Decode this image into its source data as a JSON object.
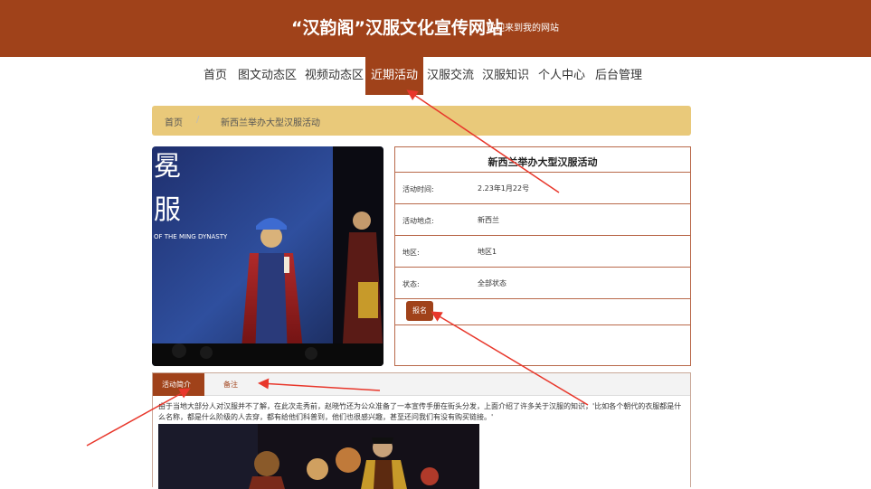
{
  "header": {
    "title": "“汉韵阁”汉服文化宣传网站",
    "subtitle": "欢迎来到我的网站",
    "bg_color": "#a0421a"
  },
  "nav": {
    "items": [
      {
        "label": "首页"
      },
      {
        "label": "图文动态区"
      },
      {
        "label": "视频动态区"
      },
      {
        "label": "近期活动"
      },
      {
        "label": "汉服交流"
      },
      {
        "label": "汉服知识"
      },
      {
        "label": "个人中心"
      },
      {
        "label": "后台管理"
      }
    ],
    "active": "近期活动"
  },
  "breadcrumb": {
    "home": "首页",
    "separator": "/",
    "current": "新西兰举办大型汉服活动"
  },
  "photo": {
    "text_1": "冕",
    "text_2": "服",
    "caption": "OF THE MING DYNASTY"
  },
  "activity": {
    "title": "新西兰举办大型汉服活动",
    "fields": [
      {
        "key": "活动时间:",
        "value": "2.23年1月22号"
      },
      {
        "key": "活动地点:",
        "value": "新西兰"
      },
      {
        "key": "地区:",
        "value": "地区1"
      },
      {
        "key": "状态:",
        "value": "全部状态"
      }
    ],
    "signup_label": "报名"
  },
  "tabs": {
    "items": [
      {
        "label": "活动简介",
        "active": true
      },
      {
        "label": "备注",
        "active": false
      }
    ],
    "description": "由于当地大部分人对汉服并不了解，在此次走秀前，赵晓竹还为公众准备了一本宣传手册在街头分发，上面介绍了许多关于汉服的知识，'比如各个朝代的衣服都是什么名称，都是什么阶级的人去穿，都有给他们科普到，他们也很感兴趣，甚至还问我们有没有购买链接。'"
  },
  "annotation_color": "#e8372b"
}
